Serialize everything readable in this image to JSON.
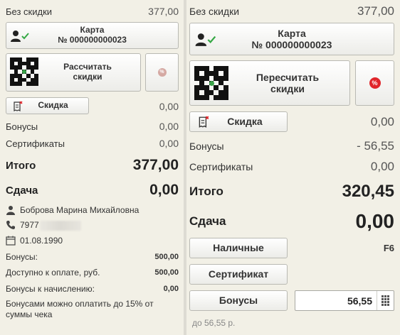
{
  "left": {
    "no_discount_label": "Без скидки",
    "no_discount_value": "377,00",
    "card_button": {
      "line1": "Карта",
      "line2": "№ 000000000023"
    },
    "recalc_button": {
      "line1": "Рассчитать",
      "line2": "скидки"
    },
    "discount_button": "Скидка",
    "discount_value": "0,00",
    "bonuses_label": "Бонусы",
    "bonuses_value": "0,00",
    "certificates_label": "Сертификаты",
    "certificates_value": "0,00",
    "total_label": "Итого",
    "total_value": "377,00",
    "change_label": "Сдача",
    "change_value": "0,00",
    "customer_name": "Боброва Марина Михайловна",
    "phone": "7977",
    "birthdate": "01.08.1990",
    "info_bonuses_label": "Бонусы:",
    "info_bonuses_value": "500,00",
    "available_label": "Доступно к оплате, руб.",
    "available_value": "500,00",
    "accrual_label": "Бонусы к начислению:",
    "accrual_value": "0,00",
    "note": "Бонусами можно оплатить до 15% от суммы чека"
  },
  "right": {
    "no_discount_label": "Без скидки",
    "no_discount_value": "377,00",
    "card_button": {
      "line1": "Карта",
      "line2": "№ 000000000023"
    },
    "recalc_button": {
      "line1": "Пересчитать",
      "line2": "скидки"
    },
    "discount_button": "Скидка",
    "discount_value": "0,00",
    "bonuses_label": "Бонусы",
    "bonuses_value": "- 56,55",
    "certificates_label": "Сертификаты",
    "certificates_value": "0,00",
    "total_label": "Итого",
    "total_value": "320,45",
    "change_label": "Сдача",
    "change_value": "0,00",
    "cash_button": "Наличные",
    "cash_hotkey": "F6",
    "certificate_button": "Сертификат",
    "bonus_button": "Бонусы",
    "bonus_input_value": "56,55",
    "limit_hint": "до 56,55 р."
  },
  "colors": {
    "background": "#f2f0e6",
    "percent_active": "#e0262b",
    "percent_inactive": "#d5a9a3",
    "check_green": "#35a845",
    "discount_icon_red": "#e0262b"
  },
  "icons": {
    "card": "person-check-icon",
    "qr": "qr-code-icon",
    "percent": "percent-icon",
    "discount": "receipt-icon",
    "person": "person-icon",
    "phone": "phone-icon",
    "calendar": "calendar-icon",
    "keypad": "keypad-icon"
  }
}
